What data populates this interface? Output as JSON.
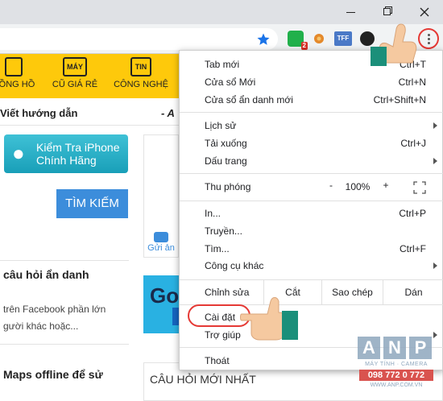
{
  "window_controls": {
    "minimize": "minimize",
    "maximize": "restore",
    "close": "close"
  },
  "nav": {
    "items": [
      {
        "icon": "",
        "label": "ĐỒNG HỒ"
      },
      {
        "icon": "MÁY",
        "label": "CŨ GIÁ RẺ"
      },
      {
        "icon": "TIN",
        "label": "CÔNG NGHỆ"
      }
    ]
  },
  "page": {
    "guide_text": "Viết hướng dẫn",
    "guide_sep": "- A",
    "iphone_button": [
      "Kiểm Tra iPhone",
      "Chính Hãng"
    ],
    "search_button": "TÌM KIẾM",
    "send_button": "Gửi ản",
    "anon_question": "câu hỏi ẩn danh",
    "snippet_lines": [
      "trên Facebook phần lớn",
      "gười khác hoặc..."
    ],
    "banner_text": "Go",
    "maps_title": "Maps offline để sử",
    "latest_title": "CÂU HỎI MỚI NHẤT"
  },
  "menu": {
    "items_top": [
      {
        "label": "Tab mới",
        "shortcut": "Ctrl+T"
      },
      {
        "label": "Cửa sổ Mới",
        "shortcut": "Ctrl+N"
      },
      {
        "label": "Cửa sổ ẩn danh mới",
        "shortcut": "Ctrl+Shift+N"
      }
    ],
    "items_history": [
      {
        "label": "Lịch sử",
        "shortcut": ""
      },
      {
        "label": "Tải xuống",
        "shortcut": "Ctrl+J"
      },
      {
        "label": "Dấu trang",
        "shortcut": ""
      }
    ],
    "zoom": {
      "label": "Thu phóng",
      "minus": "-",
      "value": "100%",
      "plus": "+"
    },
    "items_tools": [
      {
        "label": "In...",
        "shortcut": "Ctrl+P"
      },
      {
        "label": "Truyền...",
        "shortcut": ""
      },
      {
        "label": "Tìm...",
        "shortcut": "Ctrl+F"
      },
      {
        "label": "Công cụ khác",
        "shortcut": ""
      }
    ],
    "edit": {
      "label": "Chỉnh sửa",
      "cut": "Cắt",
      "copy": "Sao chép",
      "paste": "Dán"
    },
    "items_settings": [
      {
        "label": "Cài đặt",
        "shortcut": ""
      },
      {
        "label": "Trợ giúp",
        "shortcut": ""
      }
    ],
    "exit": "Thoát"
  },
  "extensions": {
    "chat_badge": "2",
    "tff": "TFF"
  },
  "watermark": {
    "letters": [
      "A",
      "N",
      "P"
    ],
    "tagline": "MÁY TÍNH · CAMERA",
    "phone": "098 772 0 772",
    "url": "WWW.ANP.COM.VN"
  },
  "colors": {
    "highlight_ring": "#e53935",
    "nav_bg": "#fec90b",
    "search_bg": "#3c8ddb"
  }
}
